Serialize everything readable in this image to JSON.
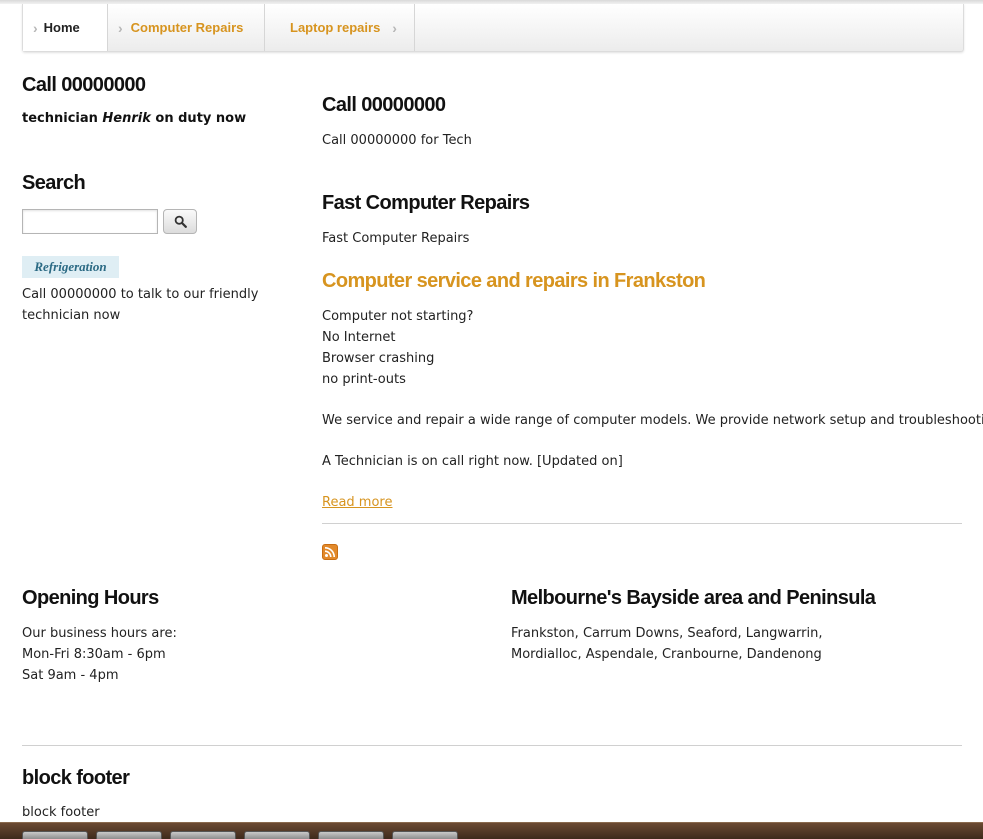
{
  "breadcrumb": {
    "items": [
      {
        "label": "Home"
      },
      {
        "label": "Computer Repairs"
      },
      {
        "label": "Laptop repairs"
      }
    ]
  },
  "sidebar": {
    "call_title": "Call 00000000",
    "duty_prefix": "technician ",
    "duty_name": "Henrik",
    "duty_suffix": " on duty now",
    "search_title": "Search",
    "search_value": "",
    "tag_label": "Refrigeration",
    "call_text": "Call 00000000 to talk to our friendly technician now"
  },
  "main": {
    "call_title": "Call 00000000",
    "call_text": "Call 00000000 for Tech",
    "fast_title": "Fast Computer Repairs",
    "fast_text": "Fast Computer Repairs",
    "service_title": "Computer service and repairs in Frankston",
    "issues": [
      "Computer not starting?",
      "No Internet",
      "Browser crashing",
      "no print-outs"
    ],
    "service_paragraph": "We service and repair a wide range of computer models. We provide network setup and troubleshooting.",
    "tech_paragraph": "A Technician is on call right now. [Updated on]",
    "read_more": "Read more"
  },
  "footer_blocks": {
    "hours_title": "Opening Hours",
    "hours": [
      "Our business hours are:",
      "Mon-Fri 8:30am - 6pm",
      "Sat 9am - 4pm"
    ],
    "bayside_title": "Melbourne's Bayside area and Peninsula",
    "bayside_text": "Frankston, Carrum Downs, Seaford, Langwarrin, Mordialloc, Aspendale, Cranbourne, Dandenong",
    "block_footer_title": "block footer",
    "block_footer_text": "block footer"
  },
  "colors": {
    "accent": "#d7941f",
    "tag_bg": "#dfeef4",
    "tag_text": "#2b6a84",
    "rss": "#e2892a"
  },
  "icons": {
    "search_button": "search-icon",
    "feed": "rss-icon",
    "breadcrumb_separator": "chevron-right-icon"
  }
}
